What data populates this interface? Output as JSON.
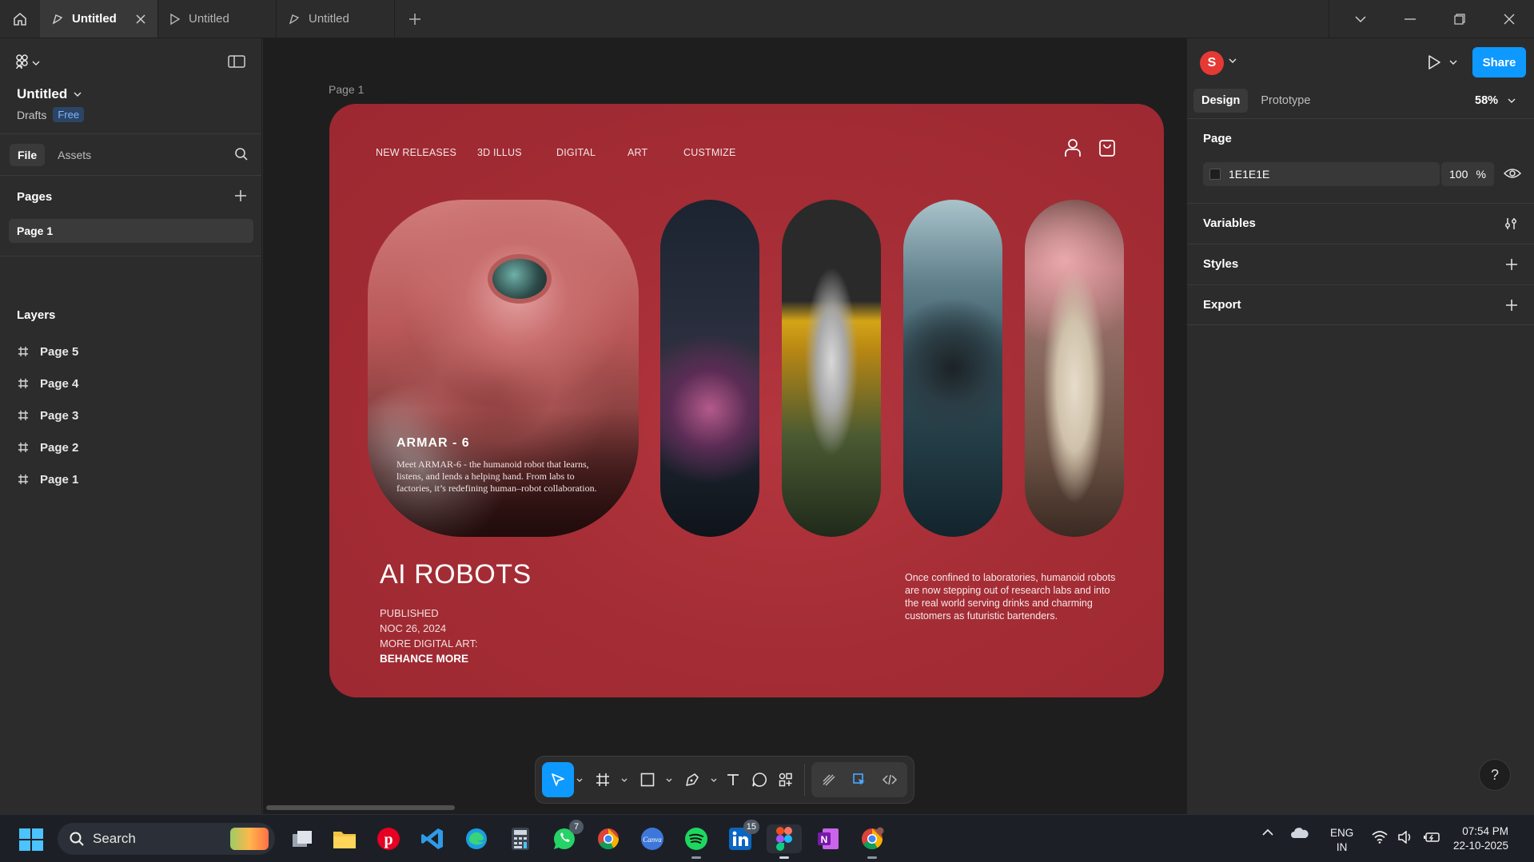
{
  "topbar": {
    "tabs": [
      {
        "label": "Untitled",
        "active": true
      },
      {
        "label": "Untitled",
        "active": false
      },
      {
        "label": "Untitled",
        "active": false
      }
    ]
  },
  "left_panel": {
    "file_name": "Untitled",
    "drafts_label": "Drafts",
    "plan_badge": "Free",
    "tabs": [
      "File",
      "Assets"
    ],
    "pages_title": "Pages",
    "pages": [
      "Page 1"
    ],
    "layers_title": "Layers",
    "layers": [
      "Page 5",
      "Page 4",
      "Page 3",
      "Page 2",
      "Page 1"
    ]
  },
  "canvas": {
    "frame_label": "Page 1",
    "nav": [
      "NEW RELEASES",
      "3D ILLUS",
      "DIGITAL",
      "ART",
      "CUSTMIZE"
    ],
    "hero": {
      "name": "ARMAR - 6",
      "description": "Meet ARMAR-6 - the humanoid robot that learns, listens, and lends a helping hand. From labs to factories, it’s redefining human–robot collaboration."
    },
    "title": "AI ROBOTS",
    "meta": [
      "PUBLISHED",
      "NOC 26, 2024",
      "MORE DIGITAL ART:",
      "BEHANCE MORE"
    ],
    "side_description": "Once confined to laboratories, humanoid robots are now stepping out of research labs and into the real world serving drinks and charming  customers as futuristic bartenders."
  },
  "toolbar": {
    "tools": [
      "move-tool",
      "frame-tool",
      "shape-tool",
      "pen-tool",
      "text-tool",
      "comment-tool",
      "resources-tool",
      "draw-mode",
      "design-mode",
      "dev-mode"
    ],
    "active": "move-tool"
  },
  "right_panel": {
    "avatar_initial": "S",
    "share_label": "Share",
    "tabs": [
      "Design",
      "Prototype"
    ],
    "zoom": "58%",
    "page_section_title": "Page",
    "page_color": "1E1E1E",
    "page_opacity": "100",
    "opacity_unit": "%",
    "sections": [
      "Variables",
      "Styles",
      "Export"
    ],
    "help_label": "?"
  },
  "taskbar": {
    "search_placeholder": "Search",
    "badges": {
      "whatsapp": "7",
      "linkedin": "15"
    },
    "lang_line1": "ENG",
    "lang_line2": "IN",
    "time": "07:54 PM",
    "date": "22-10-2025"
  },
  "colors": {
    "accent": "#0d99ff",
    "frame_bg": "#a52d35",
    "canvas_bg": "#1e1e1e",
    "panel_bg": "#2c2c2c"
  }
}
